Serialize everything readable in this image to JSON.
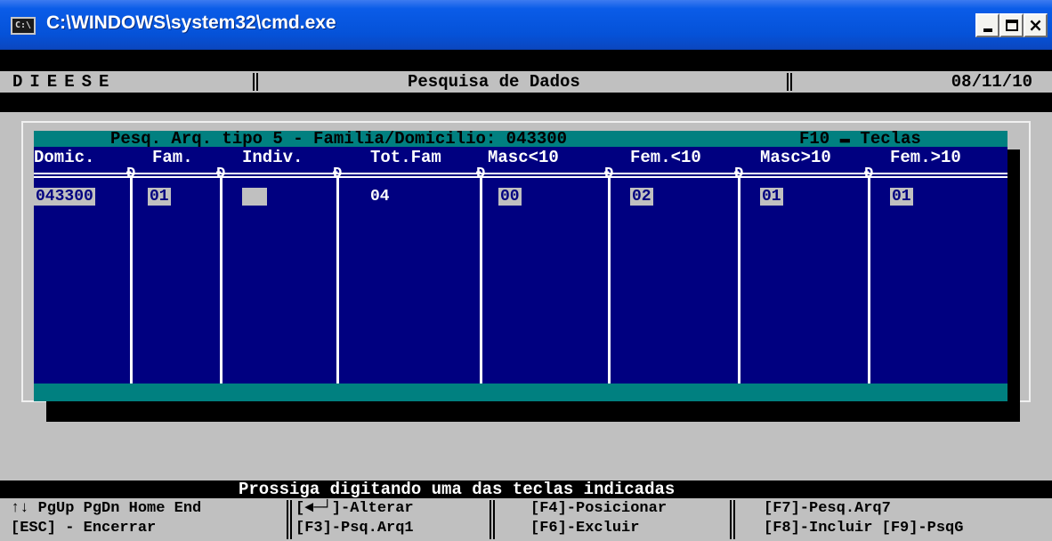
{
  "window": {
    "icon_text": "C:\\",
    "title": "C:\\WINDOWS\\system32\\cmd.exe",
    "close_glyph": "×"
  },
  "header": {
    "left": "DIEESE",
    "center": "Pesquisa de Dados",
    "date": "08/11/10"
  },
  "panel": {
    "title": "Pesq. Arq. tipo 5 - Familia/Domicilio: 043300",
    "hint": "F10 ▬ Teclas"
  },
  "table": {
    "columns": [
      "Domic.",
      "Fam.",
      "Indiv.",
      "Tot.Fam",
      "Masc<10",
      "Fem.<10",
      "Masc>10",
      "Fem.>10"
    ],
    "row": {
      "domic": "043300",
      "fam": "01",
      "indiv": "",
      "tot_fam": "04",
      "masc_lt10": "00",
      "fem_lt10": "02",
      "masc_gt10": "01",
      "fem_gt10": "01"
    }
  },
  "status": {
    "prompt": "Prossiga digitando uma das teclas indicadas",
    "keys": {
      "nav": "↑↓ PgUp PgDn Home End",
      "esc": "[ESC] - Encerrar",
      "enter": "[◄─┘]-Alterar",
      "f3": "[F3]-Psq.Arq1",
      "f4": "[F4]-Posicionar",
      "f6": "[F6]-Excluir",
      "f7": "[F7]-Pesq.Arq7",
      "f8_f9": "[F8]-Incluir [F9]-PsqG"
    }
  }
}
